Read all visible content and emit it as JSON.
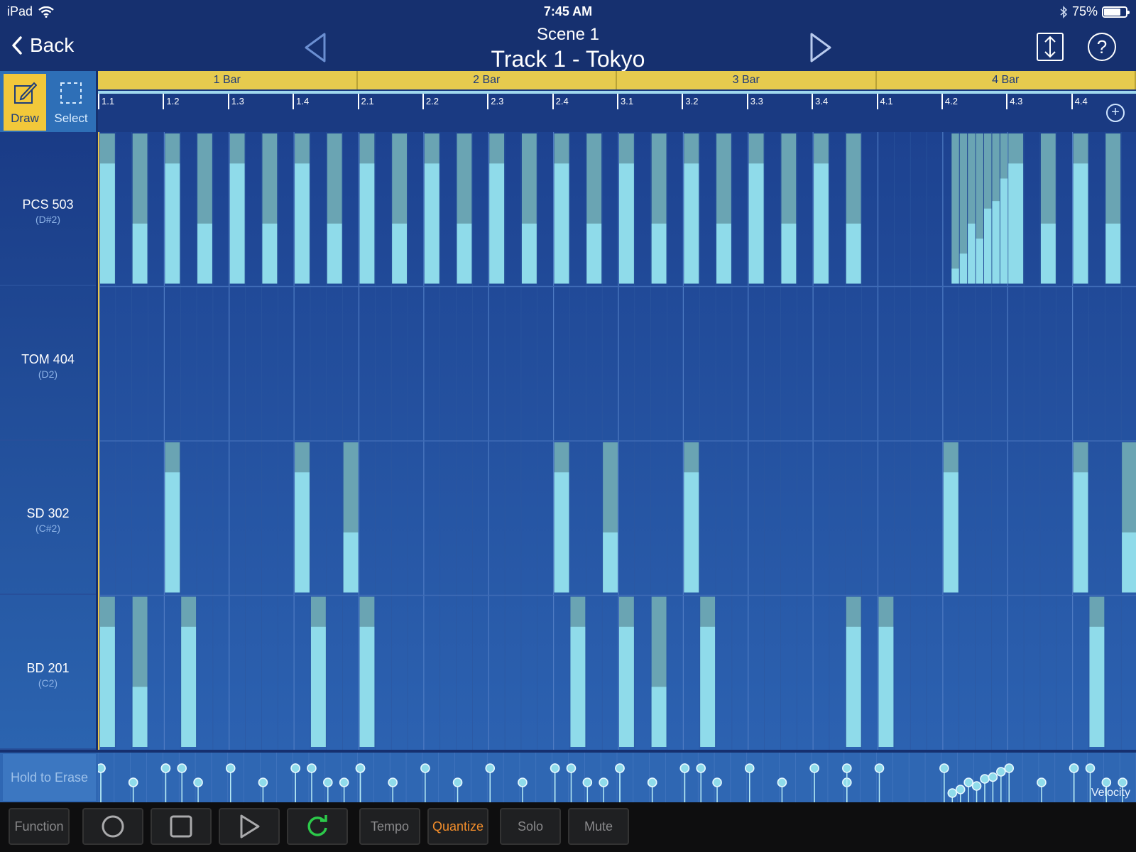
{
  "status_bar": {
    "device": "iPad",
    "time": "7:45 AM",
    "battery_percent": "75%",
    "battery_level": 0.75
  },
  "nav": {
    "back_label": "Back",
    "scene_title": "Scene  1",
    "track_title": "Track 1 - Tokyo",
    "help_label": "?"
  },
  "tools": {
    "draw_label": "Draw",
    "select_label": "Select",
    "active": "draw"
  },
  "ruler": {
    "bars": [
      "1 Bar",
      "2 Bar",
      "3 Bar",
      "4 Bar"
    ],
    "beats": [
      "1.1",
      "1.2",
      "1.3",
      "1.4",
      "2.1",
      "2.2",
      "2.3",
      "2.4",
      "3.1",
      "3.2",
      "3.3",
      "3.4",
      "4.1",
      "4.2",
      "4.3",
      "4.4"
    ],
    "add_label": "+"
  },
  "tracks": [
    {
      "name": "PCS 503",
      "note": "(D#2)"
    },
    {
      "name": "TOM 404",
      "note": "(D2)"
    },
    {
      "name": "SD 302",
      "note": "(C#2)"
    },
    {
      "name": "BD 201",
      "note": "(C2)"
    }
  ],
  "pattern": {
    "steps_per_beat": 4,
    "steps_total": 64,
    "track_notes": [
      [
        [
          0,
          0.8
        ],
        [
          2,
          0.4
        ],
        [
          4,
          0.8
        ],
        [
          6,
          0.4
        ],
        [
          8,
          0.8
        ],
        [
          10,
          0.4
        ],
        [
          12,
          0.8
        ],
        [
          14,
          0.4
        ],
        [
          16,
          0.8
        ],
        [
          18,
          0.4
        ],
        [
          20,
          0.8
        ],
        [
          22,
          0.4
        ],
        [
          24,
          0.8
        ],
        [
          26,
          0.4
        ],
        [
          28,
          0.8
        ],
        [
          30,
          0.4
        ],
        [
          32,
          0.8
        ],
        [
          34,
          0.4
        ],
        [
          36,
          0.8
        ],
        [
          38,
          0.4
        ],
        [
          40,
          0.8
        ],
        [
          42,
          0.4
        ],
        [
          44,
          0.8
        ],
        [
          46,
          0.4
        ],
        [
          52.5,
          0.1
        ],
        [
          53,
          0.2
        ],
        [
          53.5,
          0.4
        ],
        [
          54,
          0.3
        ],
        [
          54.5,
          0.5
        ],
        [
          55,
          0.55
        ],
        [
          55.5,
          0.7
        ],
        [
          56,
          0.8
        ],
        [
          58,
          0.4
        ],
        [
          60,
          0.8
        ],
        [
          62,
          0.4
        ]
      ],
      [],
      [
        [
          4,
          0.8
        ],
        [
          12,
          0.8
        ],
        [
          15,
          0.4
        ],
        [
          28,
          0.8
        ],
        [
          31,
          0.4
        ],
        [
          36,
          0.8
        ],
        [
          52,
          0.8
        ],
        [
          60,
          0.8
        ],
        [
          63,
          0.4
        ]
      ],
      [
        [
          0,
          0.8
        ],
        [
          2,
          0.4
        ],
        [
          5,
          0.8
        ],
        [
          13,
          0.8
        ],
        [
          16,
          0.8
        ],
        [
          29,
          0.8
        ],
        [
          32,
          0.8
        ],
        [
          34,
          0.4
        ],
        [
          37,
          0.8
        ],
        [
          46,
          0.8
        ],
        [
          48,
          0.8
        ],
        [
          61,
          0.8
        ]
      ]
    ]
  },
  "velocity_label": "Velocity",
  "hold_to_erase": "Hold to Erase",
  "toolbar": {
    "function": "Function",
    "tempo": "Tempo",
    "quantize": "Quantize",
    "solo": "Solo",
    "mute": "Mute"
  },
  "colors": {
    "note_fill": "#8fdbea",
    "note_dim": "#6aa4b3",
    "bar_ruler": "#e6cb4e",
    "quantize_active": "#f28d2b",
    "loop_icon": "#2cc94a"
  }
}
